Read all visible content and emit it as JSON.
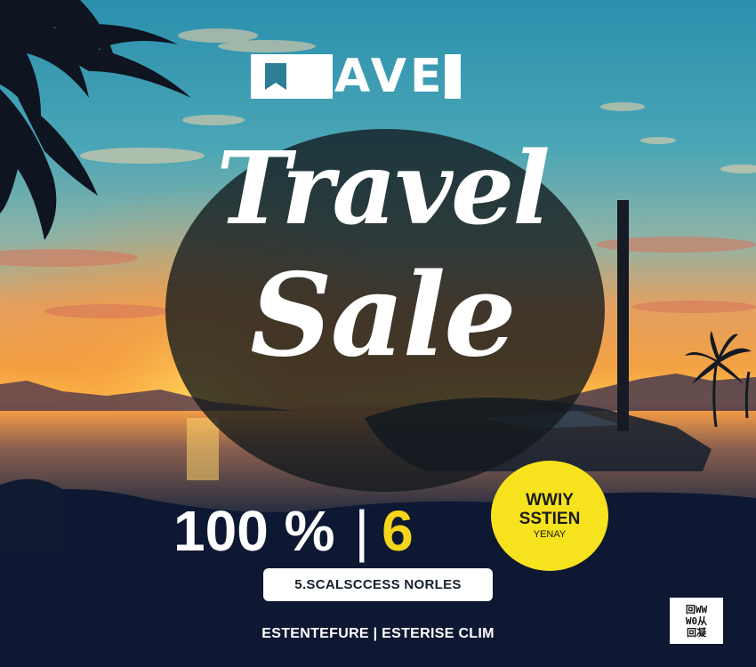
{
  "brand": {
    "logo_text": "AVE",
    "logo_icon": "bookmark-flag-icon"
  },
  "headline": {
    "line1": "Travel",
    "line2": "Sale"
  },
  "deal": {
    "percent": "100 %",
    "separator": "|",
    "number": "6"
  },
  "badge": {
    "line1": "WWIY",
    "line2": "SSTIEN",
    "line3": "YENAY"
  },
  "cta_label": "5.SCALSCCESS NORLES",
  "footer": "ESTENTEFURE | ESTERISE CLIM",
  "qr": {
    "lines": [
      "回WW",
      "W0从",
      "回凝"
    ]
  },
  "colors": {
    "accent_yellow": "#f4d41c",
    "badge_yellow": "#f6e21d",
    "overlay_dark": "#12181c",
    "text_white": "#ffffff"
  }
}
